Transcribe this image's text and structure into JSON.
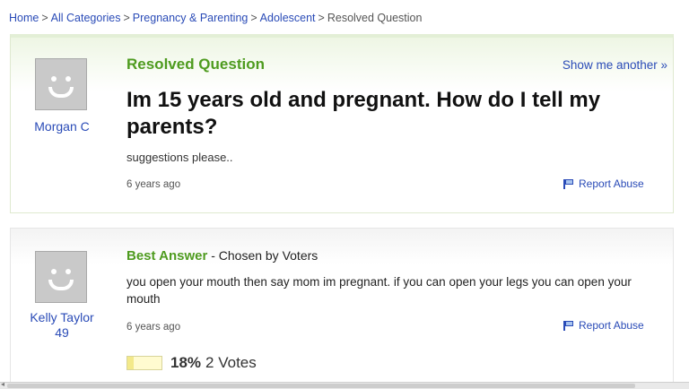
{
  "breadcrumb": {
    "home": "Home",
    "all_categories": "All Categories",
    "pregnancy": "Pregnancy & Parenting",
    "adolescent": "Adolescent",
    "current": "Resolved Question",
    "separator": ">"
  },
  "question": {
    "header": "Resolved Question",
    "show_another": "Show me another »",
    "asker": "Morgan C",
    "title": "Im 15 years old and pregnant. How do I tell my parents?",
    "details": "suggestions please..",
    "time": "6 years ago",
    "report": "Report Abuse"
  },
  "answer": {
    "header": "Best Answer",
    "chosen_by": "- Chosen by Voters",
    "answerer": "Kelly Taylor",
    "answerer_level": "49",
    "text": "you open your mouth then say mom im pregnant. if you can open your legs you can open your mouth",
    "time": "6 years ago",
    "report": "Report Abuse",
    "vote_percent_label": "18%",
    "vote_fraction": 0.18,
    "votes_label": "2 Votes"
  },
  "colors": {
    "link": "#2a4bb7",
    "green_heading": "#4e9b1f"
  },
  "icons": {
    "avatar": "default-smiley-avatar",
    "report": "flag-icon"
  }
}
